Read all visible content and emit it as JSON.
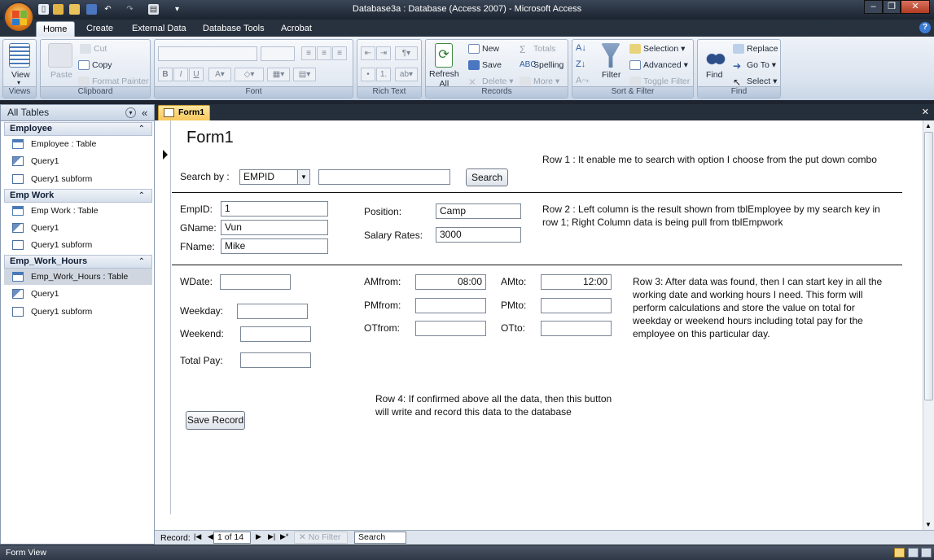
{
  "window": {
    "title": "Database3a : Database (Access 2007) - Microsoft Access",
    "minimize": "–",
    "restore": "❐",
    "close": "✕"
  },
  "ribbon": {
    "tabs": [
      "Home",
      "Create",
      "External Data",
      "Database Tools",
      "Acrobat"
    ],
    "groups": {
      "views": {
        "label": "Views",
        "view": "View"
      },
      "clipboard": {
        "label": "Clipboard",
        "paste": "Paste",
        "cut": "Cut",
        "copy": "Copy",
        "format_painter": "Format Painter"
      },
      "font": {
        "label": "Font"
      },
      "rich_text": {
        "label": "Rich Text"
      },
      "records": {
        "label": "Records",
        "refresh": "Refresh",
        "refresh2": "All",
        "new": "New",
        "save": "Save",
        "delete": "Delete",
        "totals": "Totals",
        "spelling": "Spelling",
        "more": "More"
      },
      "sort_filter": {
        "label": "Sort & Filter",
        "filter": "Filter",
        "selection": "Selection",
        "advanced": "Advanced",
        "toggle_filter": "Toggle Filter"
      },
      "find": {
        "label": "Find",
        "find": "Find",
        "replace": "Replace",
        "go_to": "Go To",
        "select": "Select"
      }
    }
  },
  "nav_pane": {
    "header": "All Tables",
    "groups": [
      {
        "name": "Employee",
        "items": [
          "Employee : Table",
          "Query1",
          "Query1 subform"
        ]
      },
      {
        "name": "Emp Work",
        "items": [
          "Emp Work : Table",
          "Query1",
          "Query1 subform"
        ]
      },
      {
        "name": "Emp_Work_Hours",
        "items": [
          "Emp_Work_Hours : Table",
          "Query1",
          "Query1 subform"
        ]
      }
    ]
  },
  "document": {
    "tab": "Form1",
    "close": "✕"
  },
  "form": {
    "title": "Form1",
    "search_by_label": "Search by :",
    "search_by_value": "EMPID",
    "search_text": "",
    "search_button": "Search",
    "row1_note": "Row 1 : It enable me to search with option I choose from the put down combo",
    "empid_label": "EmpID:",
    "empid_value": "1",
    "gname_label": "GName:",
    "gname_value": "Vun",
    "fname_label": "FName:",
    "fname_value": "Mike",
    "position_label": "Position:",
    "position_value": "Camp",
    "salary_label": "Salary Rates:",
    "salary_value": "3000",
    "row2_note_1": "Row 2 : Left column is the result shown from tblEmployee by my search key in",
    "row2_note_2": "row 1; Right Column data is being pull from tblEmpwork",
    "wdate_label": "WDate:",
    "wdate_value": "",
    "weekday_label": "Weekday:",
    "weekday_value": "",
    "weekend_label": "Weekend:",
    "weekend_value": "",
    "totalpay_label": "Total Pay:",
    "totalpay_value": "",
    "amfrom_label": "AMfrom:",
    "amfrom_value": "08:00",
    "pmfrom_label": "PMfrom:",
    "pmfrom_value": "",
    "otfrom_label": "OTfrom:",
    "otfrom_value": "",
    "amto_label": "AMto:",
    "amto_value": "12:00",
    "pmto_label": "PMto:",
    "pmto_value": "",
    "otto_label": "OTto:",
    "otto_value": "",
    "row3_note": [
      "Row 3: After data was found, then I can start key in all the",
      "working date and working hours I need. This form will",
      "perform calculations and store the value on total for",
      "weekday or weekend  hours including total pay for the",
      "employee on this particular day."
    ],
    "row4_note": [
      "Row 4: If confirmed above all the data, then this button",
      "will write and record this data to the database"
    ],
    "save_button": "Save Record"
  },
  "record_nav": {
    "label": "Record:",
    "position": "1 of 14",
    "no_filter": "No Filter",
    "search": "Search"
  },
  "status": {
    "text": "Form View"
  },
  "colors": {
    "accent": "#f7c75b",
    "titlebar": "#1b2330",
    "ribbon": "#d9e2ee"
  }
}
